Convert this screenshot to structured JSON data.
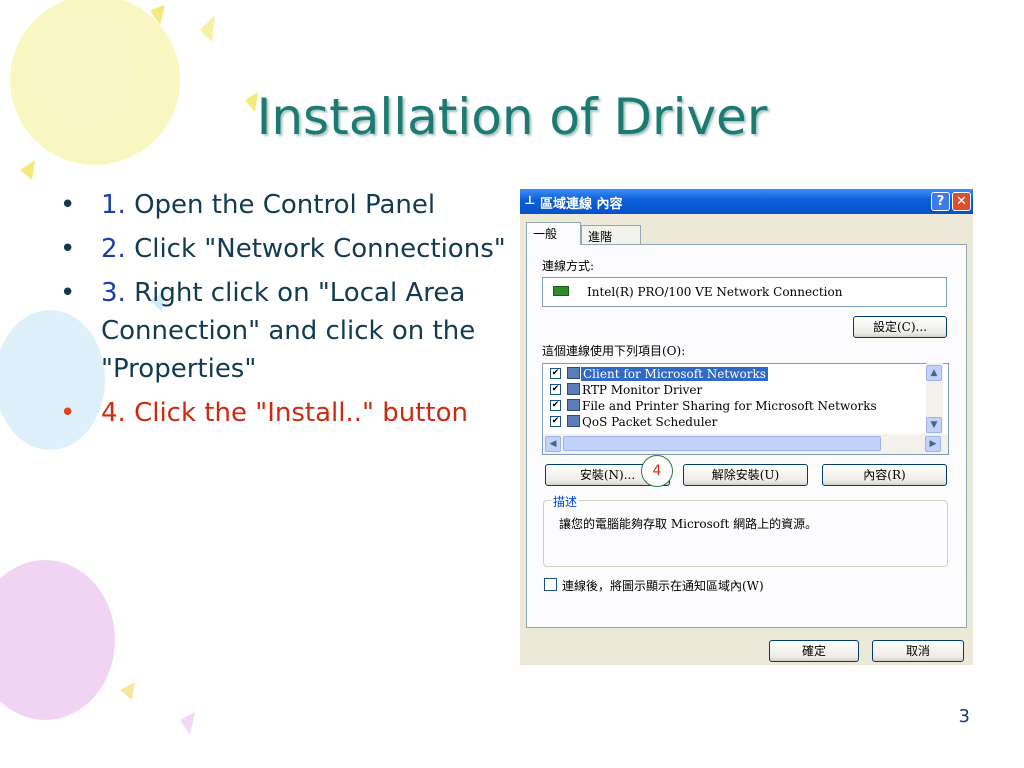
{
  "slide": {
    "title": "Installation of Driver",
    "page_number": "3",
    "steps": [
      {
        "number": "1.",
        "text": " Open the Control Panel"
      },
      {
        "number": "2.",
        "text": " Click \"Network Connections\""
      },
      {
        "number": "3.",
        "text": " Right click on \"Local Area Connection\" and click on the \"Properties\""
      },
      {
        "number": "4.",
        "text": " Click the \"Install..\" button"
      }
    ],
    "bullet_char": "•",
    "colors": {
      "title": "#1c7a72",
      "number": "#1a3fa8",
      "highlight": "#cc2b10"
    }
  },
  "dialog": {
    "title": "區域連線 內容",
    "help_label": "?",
    "close_label": "✕",
    "tabs": [
      {
        "label": "一般"
      },
      {
        "label": "進階"
      }
    ],
    "connect_using_label": "連線方式:",
    "adapter_name": "Intel(R) PRO/100 VE Network Connection",
    "configure_label": "設定(C)...",
    "components_label": "這個連線使用下列項目(O):",
    "components": [
      {
        "name": "Client for Microsoft Networks",
        "checked": "✔"
      },
      {
        "name": "RTP Monitor Driver",
        "checked": "✔"
      },
      {
        "name": "File and Printer Sharing for Microsoft Networks",
        "checked": "✔"
      },
      {
        "name": "QoS Packet Scheduler",
        "checked": "✔"
      }
    ],
    "scroll": {
      "up": "▲",
      "down": "▼",
      "left": "◀",
      "right": "▶"
    },
    "install_label": "安裝(N)...",
    "uninstall_label": "解除安裝(U)",
    "properties_label": "內容(R)",
    "callout_number": "4",
    "description_legend": "描述",
    "description_text": "讓您的電腦能夠存取 Microsoft 網路上的資源。",
    "show_icon_label": "連線後，將圖示顯示在通知區域內(W)",
    "ok_label": "確定",
    "cancel_label": "取消"
  }
}
